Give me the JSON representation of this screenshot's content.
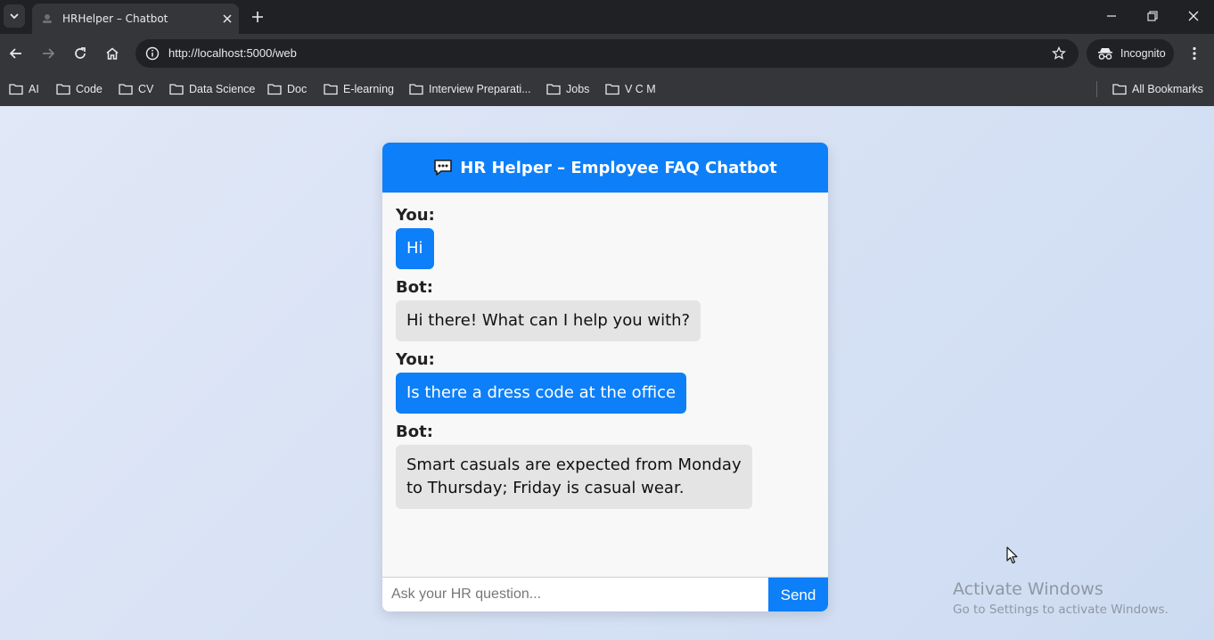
{
  "browser": {
    "tab": {
      "title": "HRHelper – Chatbot"
    },
    "url": "http://localhost:5000/web",
    "profile_label": "Incognito",
    "bookmarks": [
      "AI",
      "Code",
      "CV",
      "Data Science",
      "Doc",
      "E-learning",
      "Interview Preparati...",
      "Jobs",
      "V C M"
    ],
    "all_bookmarks_label": "All Bookmarks"
  },
  "chat": {
    "header_title": "HR Helper – Employee FAQ Chatbot",
    "messages": [
      {
        "sender": "You:",
        "role": "user",
        "text": "Hi"
      },
      {
        "sender": "Bot:",
        "role": "bot",
        "text": "Hi there! What can I help you with?"
      },
      {
        "sender": "You:",
        "role": "user",
        "text": "Is there a dress code at the office"
      },
      {
        "sender": "Bot:",
        "role": "bot",
        "text": "Smart casuals are expected from Monday to Thursday; Friday is casual wear."
      }
    ],
    "input_placeholder": "Ask your HR question...",
    "input_value": "",
    "send_label": "Send"
  },
  "watermark": {
    "line1": "Activate Windows",
    "line2": "Go to Settings to activate Windows."
  },
  "colors": {
    "accent": "#0d7ff8",
    "bot_bubble": "#e4e4e4",
    "chrome_dark": "#202124",
    "chrome_toolbar": "#35363a"
  }
}
